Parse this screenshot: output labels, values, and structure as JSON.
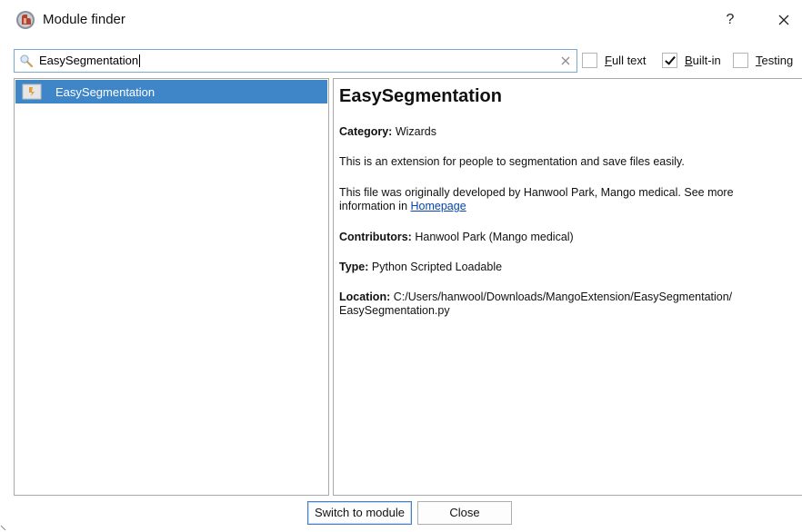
{
  "window": {
    "title": "Module finder",
    "help_label": "?",
    "app_icon": "slicer-app-icon",
    "close_icon": "close-icon"
  },
  "search": {
    "value": "EasySegmentation",
    "placeholder": "",
    "search_icon": "magnifier-icon",
    "clear_icon": "clear-icon"
  },
  "filters": {
    "full_text": {
      "label_ul": "F",
      "label_rest": "ull text",
      "checked": false
    },
    "built_in": {
      "label_ul": "B",
      "label_rest": "uilt-in",
      "checked": true
    },
    "testing": {
      "label_ul": "T",
      "label_rest": "esting",
      "checked": false
    }
  },
  "modules": [
    {
      "label": "EasySegmentation",
      "icon": "module-icon",
      "selected": true
    }
  ],
  "details": {
    "title": "EasySegmentation",
    "category_label": "Category:",
    "category_value": "Wizards",
    "description": "This is an extension for people to segmentation and save files easily.",
    "ack_line1": "This file was originally developed by Hanwool Park, Mango medical. See more",
    "ack_line2_prefix": "information in ",
    "ack_link": "Homepage",
    "contributors_label": "Contributors:",
    "contributors_value": "Hanwool Park (Mango medical)",
    "type_label": "Type:",
    "type_value": "Python Scripted Loadable",
    "location_label": "Location:",
    "location_value_line1": "C:/Users/hanwool/Downloads/MangoExtension/EasySegmentation/",
    "location_value_line2": "EasySegmentation.py"
  },
  "buttons": {
    "switch_label": "Switch to module",
    "close_label": "Close"
  }
}
